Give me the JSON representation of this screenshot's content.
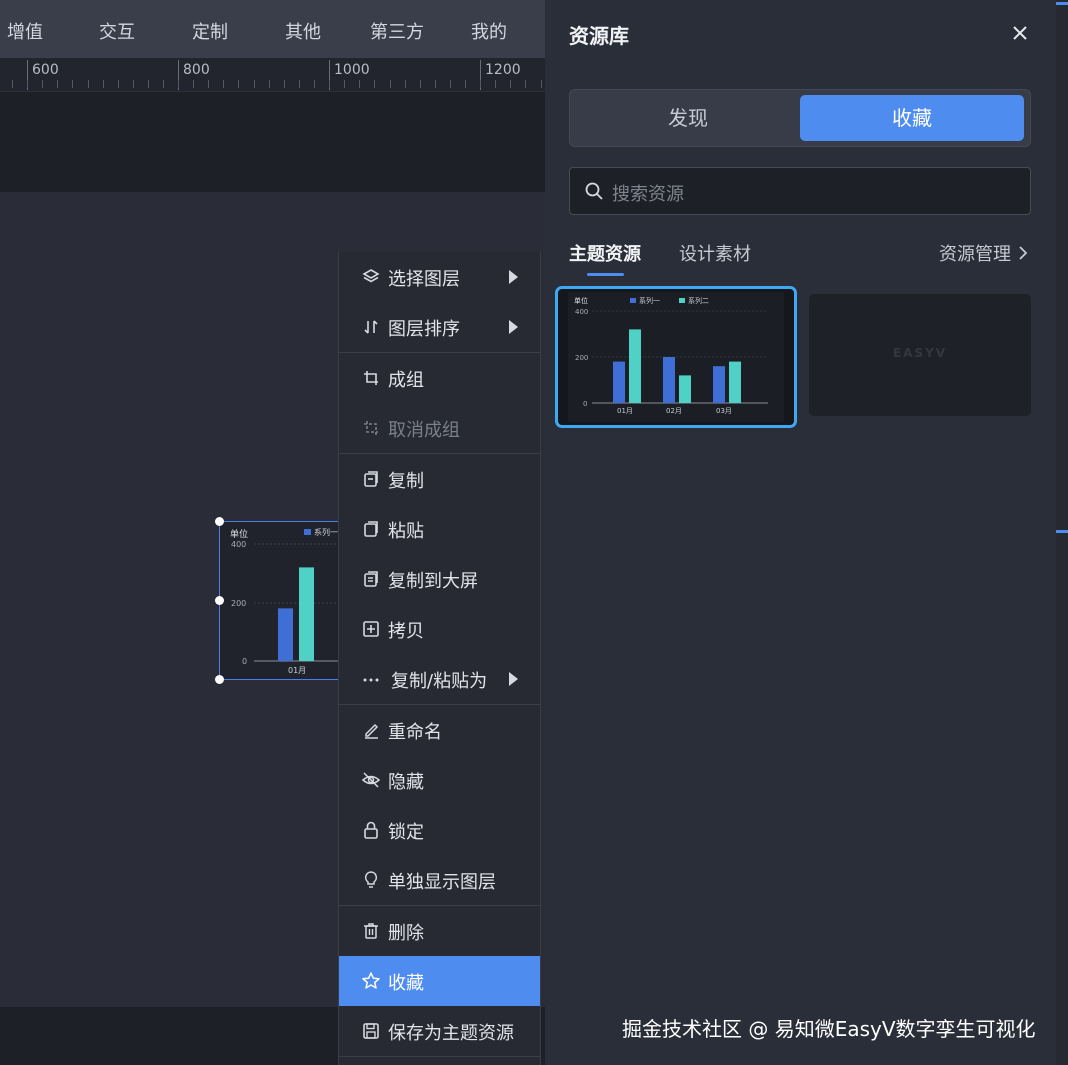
{
  "topnav": {
    "tabs": [
      "增值",
      "交互",
      "定制",
      "其他",
      "第三方",
      "我的"
    ]
  },
  "ruler": {
    "labels": [
      "600",
      "800",
      "1000",
      "1200"
    ]
  },
  "canvas_chart": {
    "unit_label": "单位",
    "legend_series1": "系列一",
    "y_ticks": [
      "400",
      "200",
      "0"
    ],
    "x_label": "01月"
  },
  "context_menu": {
    "items": [
      {
        "label": "选择图层",
        "icon": "layers-icon",
        "submenu": true
      },
      {
        "label": "图层排序",
        "icon": "sort-icon",
        "submenu": true
      },
      {
        "label": "成组",
        "icon": "group-icon"
      },
      {
        "label": "取消成组",
        "icon": "ungroup-icon",
        "disabled": true
      },
      {
        "label": "复制",
        "icon": "copy-icon"
      },
      {
        "label": "粘贴",
        "icon": "paste-icon"
      },
      {
        "label": "复制到大屏",
        "icon": "copy-to-screen-icon"
      },
      {
        "label": "拷贝",
        "icon": "duplicate-icon"
      },
      {
        "label": "复制/粘贴为",
        "icon": "more-icon",
        "submenu": true
      },
      {
        "label": "重命名",
        "icon": "rename-icon"
      },
      {
        "label": "隐藏",
        "icon": "hide-icon"
      },
      {
        "label": "锁定",
        "icon": "lock-icon"
      },
      {
        "label": "单独显示图层",
        "icon": "bulb-icon"
      },
      {
        "label": "删除",
        "icon": "trash-icon"
      },
      {
        "label": "收藏",
        "icon": "star-icon",
        "active": true
      },
      {
        "label": "保存为主题资源",
        "icon": "save-icon"
      }
    ]
  },
  "panel": {
    "title": "资源库",
    "close_icon": "close-icon",
    "segments": [
      "发现",
      "收藏"
    ],
    "active_segment": "收藏",
    "search": {
      "placeholder": "搜索资源"
    },
    "subtabs": [
      "主题资源",
      "设计素材"
    ],
    "manage_link": "资源管理",
    "card1_chart": {
      "unit_label": "单位",
      "legend": [
        "系列一",
        "系列二"
      ],
      "y_ticks": [
        "400",
        "200",
        "0"
      ],
      "x_labels": [
        "01月",
        "02月",
        "03月"
      ]
    },
    "card2_logo": "EASYV"
  },
  "chart_data": {
    "type": "bar",
    "categories": [
      "01月",
      "02月",
      "03月"
    ],
    "series": [
      {
        "name": "系列一",
        "values": [
          180,
          200,
          160
        ]
      },
      {
        "name": "系列二",
        "values": [
          320,
          120,
          180
        ]
      }
    ],
    "title": "",
    "ylabel": "单位",
    "ylim": [
      0,
      400
    ]
  },
  "colors": {
    "accent": "#4e8cf0",
    "series1": "#3f6fd6",
    "series2": "#4fd1c5"
  },
  "watermark": "掘金技术社区 @ 易知微EasyV数字孪生可视化"
}
